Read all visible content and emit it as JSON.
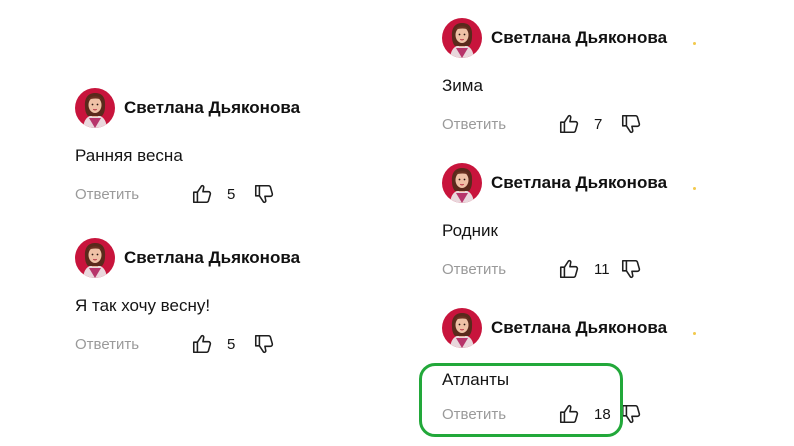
{
  "colors": {
    "highlight": "#22a83a",
    "avatar_bg": "#c8143c",
    "reply_text": "#9a9a9a"
  },
  "icons": {
    "like": "thumbs-up-icon",
    "dislike": "thumbs-down-icon",
    "avatar": "avatar-portrait"
  },
  "comments": [
    {
      "author": "Светлана Дьяконова",
      "text": "Ранняя весна",
      "reply_label": "Ответить",
      "likes": "5"
    },
    {
      "author": "Светлана Дьяконова",
      "text": "Я так хочу весну!",
      "reply_label": "Ответить",
      "likes": "5"
    },
    {
      "author": "Светлана Дьяконова",
      "text": "Зима",
      "reply_label": "Ответить",
      "likes": "7"
    },
    {
      "author": "Светлана Дьяконова",
      "text": "Родник",
      "reply_label": "Ответить",
      "likes": "11"
    },
    {
      "author": "Светлана Дьяконова",
      "text": "Атланты",
      "reply_label": "Ответить",
      "likes": "18",
      "highlighted": true
    }
  ]
}
